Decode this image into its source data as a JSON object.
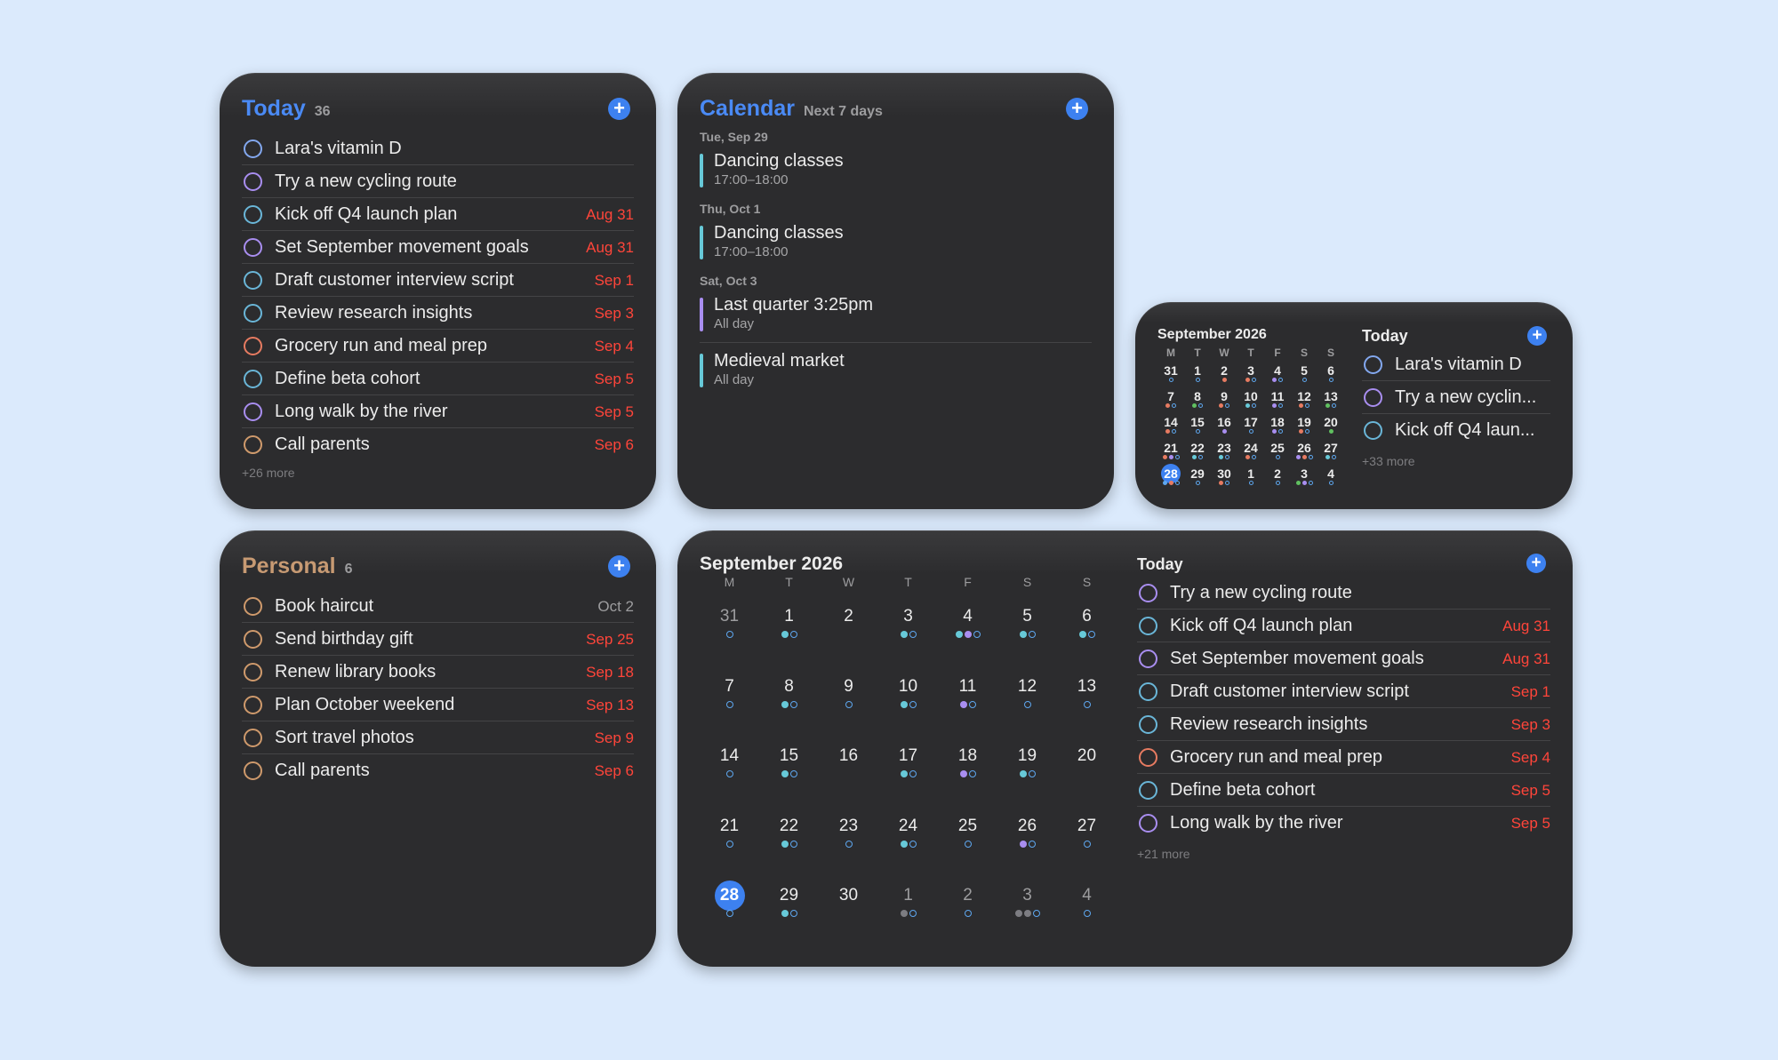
{
  "today_widget": {
    "title": "Today",
    "count": "36",
    "more": "+26 more",
    "tasks": [
      {
        "label": "Lara's vitamin D",
        "due": "",
        "color": "blue"
      },
      {
        "label": "Try a new cycling route",
        "due": "",
        "color": "purple"
      },
      {
        "label": "Kick off Q4 launch plan",
        "due": "Aug 31",
        "color": "cyan"
      },
      {
        "label": "Set September movement goals",
        "due": "Aug 31",
        "color": "purple"
      },
      {
        "label": "Draft customer interview script",
        "due": "Sep 1",
        "color": "cyan"
      },
      {
        "label": "Review research insights",
        "due": "Sep 3",
        "color": "cyan"
      },
      {
        "label": "Grocery run and meal prep",
        "due": "Sep 4",
        "color": "orange"
      },
      {
        "label": "Define beta cohort",
        "due": "Sep 5",
        "color": "cyan"
      },
      {
        "label": "Long walk by the river",
        "due": "Sep 5",
        "color": "purple"
      },
      {
        "label": "Call parents",
        "due": "Sep 6",
        "color": "tan"
      }
    ]
  },
  "calendar_widget": {
    "title": "Calendar",
    "subtitle": "Next 7 days",
    "days": [
      {
        "label": "Tue, Sep 29",
        "events": [
          {
            "title": "Dancing classes",
            "time": "17:00–18:00",
            "color": "#67c9d8"
          }
        ]
      },
      {
        "label": "Thu, Oct 1",
        "events": [
          {
            "title": "Dancing classes",
            "time": "17:00–18:00",
            "color": "#67c9d8"
          }
        ]
      },
      {
        "label": "Sat, Oct 3",
        "events": [
          {
            "title": "Last quarter 3:25pm",
            "time": "All day",
            "color": "#a98ef0"
          },
          {
            "title": "Medieval market",
            "time": "All day",
            "color": "#67c9d8"
          }
        ]
      }
    ]
  },
  "small_widget": {
    "month_title": "September 2026",
    "side_title": "Today",
    "more": "+33 more",
    "tasks": [
      {
        "label": "Lara's vitamin D",
        "color": "blue"
      },
      {
        "label": "Try a new cyclin...",
        "color": "purple"
      },
      {
        "label": "Kick off Q4 laun...",
        "color": "cyan"
      }
    ]
  },
  "personal_widget": {
    "title": "Personal",
    "count": "6",
    "tasks": [
      {
        "label": "Book haircut",
        "due": "Oct 2",
        "due_style": "grey",
        "color": "tan"
      },
      {
        "label": "Send birthday gift",
        "due": "Sep 25",
        "due_style": "red",
        "color": "tan"
      },
      {
        "label": "Renew library books",
        "due": "Sep 18",
        "due_style": "red",
        "color": "tan"
      },
      {
        "label": "Plan October weekend",
        "due": "Sep 13",
        "due_style": "red",
        "color": "tan"
      },
      {
        "label": "Sort travel photos",
        "due": "Sep 9",
        "due_style": "red",
        "color": "tan"
      },
      {
        "label": "Call parents",
        "due": "Sep 6",
        "due_style": "red",
        "color": "tan"
      }
    ]
  },
  "month_widget": {
    "month_title": "September 2026",
    "side_title": "Today",
    "more": "+21 more",
    "tasks": [
      {
        "label": "Try a new cycling route",
        "due": "",
        "color": "purple"
      },
      {
        "label": "Kick off Q4 launch plan",
        "due": "Aug 31",
        "color": "cyan"
      },
      {
        "label": "Set September movement goals",
        "due": "Aug 31",
        "color": "purple"
      },
      {
        "label": "Draft customer interview script",
        "due": "Sep 1",
        "color": "cyan"
      },
      {
        "label": "Review research insights",
        "due": "Sep 3",
        "color": "cyan"
      },
      {
        "label": "Grocery run and meal prep",
        "due": "Sep 4",
        "color": "orange"
      },
      {
        "label": "Define beta cohort",
        "due": "Sep 5",
        "color": "cyan"
      },
      {
        "label": "Long walk by the river",
        "due": "Sep 5",
        "color": "purple"
      }
    ]
  },
  "weekday_headers": [
    "M",
    "T",
    "W",
    "T",
    "F",
    "S",
    "S"
  ],
  "calendar_days": [
    {
      "n": "31",
      "out": true,
      "dots": [
        "ring"
      ]
    },
    {
      "n": "1",
      "dots": [
        "cyan",
        "ring"
      ]
    },
    {
      "n": "2",
      "dots": []
    },
    {
      "n": "3",
      "dots": [
        "cyan",
        "ring"
      ]
    },
    {
      "n": "4",
      "dots": [
        "cyan",
        "purple",
        "ring"
      ]
    },
    {
      "n": "5",
      "dots": [
        "cyan",
        "ring"
      ]
    },
    {
      "n": "6",
      "dots": [
        "cyan",
        "ring"
      ]
    },
    {
      "n": "7",
      "dots": [
        "ring"
      ]
    },
    {
      "n": "8",
      "dots": [
        "cyan",
        "ring"
      ]
    },
    {
      "n": "9",
      "dots": [
        "ring"
      ]
    },
    {
      "n": "10",
      "dots": [
        "cyan",
        "ring"
      ]
    },
    {
      "n": "11",
      "dots": [
        "purple",
        "ring"
      ]
    },
    {
      "n": "12",
      "dots": [
        "ring"
      ]
    },
    {
      "n": "13",
      "dots": [
        "ring"
      ]
    },
    {
      "n": "14",
      "dots": [
        "ring"
      ]
    },
    {
      "n": "15",
      "dots": [
        "cyan",
        "ring"
      ]
    },
    {
      "n": "16",
      "dots": []
    },
    {
      "n": "17",
      "dots": [
        "cyan",
        "ring"
      ]
    },
    {
      "n": "18",
      "dots": [
        "purple",
        "ring"
      ]
    },
    {
      "n": "19",
      "dots": [
        "cyan",
        "ring"
      ]
    },
    {
      "n": "20",
      "dots": []
    },
    {
      "n": "21",
      "dots": [
        "ring"
      ]
    },
    {
      "n": "22",
      "dots": [
        "cyan",
        "ring"
      ]
    },
    {
      "n": "23",
      "dots": [
        "ring"
      ]
    },
    {
      "n": "24",
      "dots": [
        "cyan",
        "ring"
      ]
    },
    {
      "n": "25",
      "dots": [
        "ring"
      ]
    },
    {
      "n": "26",
      "dots": [
        "purple",
        "ring"
      ]
    },
    {
      "n": "27",
      "dots": [
        "ring"
      ]
    },
    {
      "n": "28",
      "today": true,
      "dots": [
        "ring"
      ]
    },
    {
      "n": "29",
      "dots": [
        "cyan",
        "ring"
      ]
    },
    {
      "n": "30",
      "dots": []
    },
    {
      "n": "1",
      "out": true,
      "dots": [
        "grey",
        "ring"
      ]
    },
    {
      "n": "2",
      "out": true,
      "dots": [
        "ring"
      ]
    },
    {
      "n": "3",
      "out": true,
      "dots": [
        "grey",
        "grey",
        "ring"
      ]
    },
    {
      "n": "4",
      "out": true,
      "dots": [
        "ring"
      ]
    }
  ],
  "mini_days": [
    {
      "n": "31",
      "dots": [
        "ring"
      ]
    },
    {
      "n": "1",
      "dots": [
        "ring"
      ]
    },
    {
      "n": "2",
      "dots": [
        "orange"
      ]
    },
    {
      "n": "3",
      "dots": [
        "orange",
        "ring"
      ]
    },
    {
      "n": "4",
      "dots": [
        "purple",
        "ring"
      ]
    },
    {
      "n": "5",
      "dots": [
        "ring"
      ]
    },
    {
      "n": "6",
      "dots": [
        "ring"
      ]
    },
    {
      "n": "7",
      "dots": [
        "orange",
        "ring"
      ]
    },
    {
      "n": "8",
      "dots": [
        "green",
        "ring"
      ]
    },
    {
      "n": "9",
      "dots": [
        "orange",
        "ring"
      ]
    },
    {
      "n": "10",
      "dots": [
        "cyan",
        "ring"
      ]
    },
    {
      "n": "11",
      "dots": [
        "purple",
        "ring"
      ]
    },
    {
      "n": "12",
      "dots": [
        "orange",
        "ring"
      ]
    },
    {
      "n": "13",
      "dots": [
        "green",
        "ring"
      ]
    },
    {
      "n": "14",
      "dots": [
        "orange",
        "ring"
      ]
    },
    {
      "n": "15",
      "dots": [
        "ring"
      ]
    },
    {
      "n": "16",
      "dots": [
        "purple"
      ]
    },
    {
      "n": "17",
      "dots": [
        "ring"
      ]
    },
    {
      "n": "18",
      "dots": [
        "purple",
        "ring"
      ]
    },
    {
      "n": "19",
      "dots": [
        "orange",
        "ring"
      ]
    },
    {
      "n": "20",
      "dots": [
        "green"
      ]
    },
    {
      "n": "21",
      "dots": [
        "orange",
        "purple",
        "ring"
      ]
    },
    {
      "n": "22",
      "dots": [
        "cyan",
        "ring"
      ]
    },
    {
      "n": "23",
      "dots": [
        "cyan",
        "ring"
      ]
    },
    {
      "n": "24",
      "dots": [
        "orange",
        "ring"
      ]
    },
    {
      "n": "25",
      "dots": [
        "ring"
      ]
    },
    {
      "n": "26",
      "dots": [
        "purple",
        "orange",
        "ring"
      ]
    },
    {
      "n": "27",
      "dots": [
        "cyan",
        "ring"
      ]
    },
    {
      "n": "28",
      "dots": [
        "blue",
        "orange",
        "ring"
      ]
    },
    {
      "n": "29",
      "dots": [
        "ring"
      ]
    },
    {
      "n": "30",
      "dots": [
        "orange",
        "ring"
      ]
    },
    {
      "n": "1",
      "dots": [
        "ring"
      ]
    },
    {
      "n": "2",
      "dots": [
        "ring"
      ]
    },
    {
      "n": "3",
      "dots": [
        "green",
        "purple",
        "ring"
      ]
    },
    {
      "n": "4",
      "dots": [
        "ring"
      ]
    }
  ],
  "colors": {
    "background": "#dbeafc",
    "widget": "#2c2c2e",
    "accent_blue": "#3d81f0",
    "today_title": "#4a8af5",
    "personal_title": "#c79a73",
    "due_red": "#ff453a"
  },
  "icons": {
    "add": "plus-circle-icon",
    "task": "circle-outline-icon"
  }
}
